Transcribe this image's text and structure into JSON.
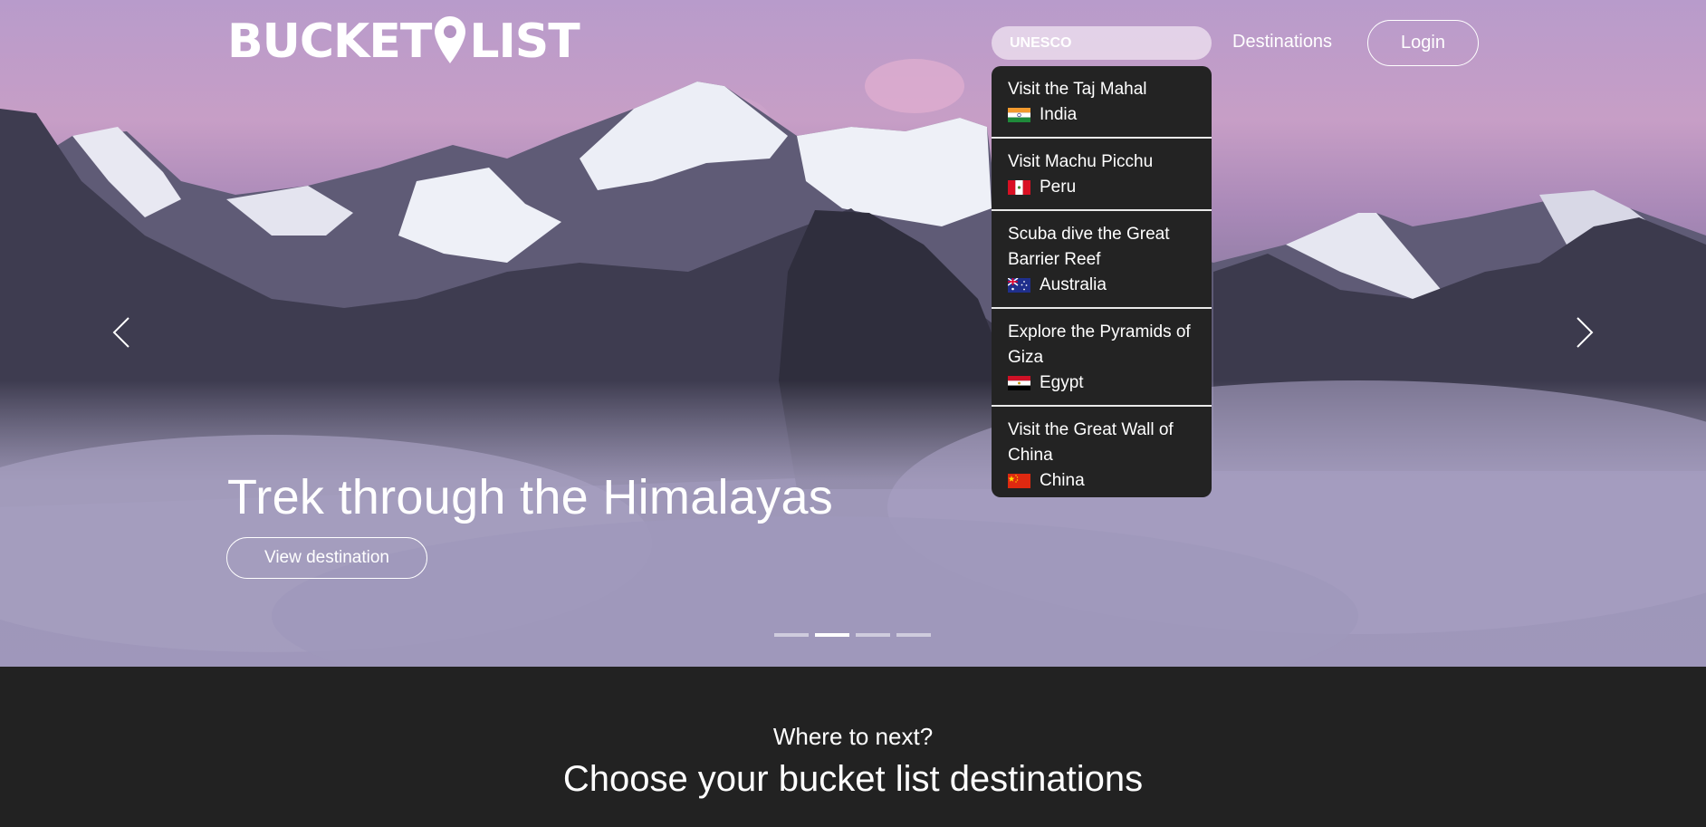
{
  "header": {
    "logo_text_left": "BUCKET",
    "logo_text_right": "LIST",
    "search_value": "UNESCO",
    "nav_destinations": "Destinations",
    "login_label": "Login"
  },
  "search_results": [
    {
      "title": "Visit the Taj Mahal",
      "country": "India",
      "flag_icon": "india-flag-icon"
    },
    {
      "title": "Visit Machu Picchu",
      "country": "Peru",
      "flag_icon": "peru-flag-icon"
    },
    {
      "title": "Scuba dive the Great Barrier Reef",
      "country": "Australia",
      "flag_icon": "australia-flag-icon"
    },
    {
      "title": "Explore the Pyramids of Giza",
      "country": "Egypt",
      "flag_icon": "egypt-flag-icon"
    },
    {
      "title": "Visit the Great Wall of China",
      "country": "China",
      "flag_icon": "china-flag-icon"
    }
  ],
  "hero": {
    "headline": "Trek through the Himalayas",
    "cta_label": "View destination",
    "slide_count": 4,
    "active_slide": 2,
    "prev_icon": "chevron-left-icon",
    "next_icon": "chevron-right-icon"
  },
  "section": {
    "subtitle": "Where to next?",
    "title": "Choose your bucket list destinations"
  },
  "colors": {
    "dark_background": "#222222",
    "dropdown_background": "#232323",
    "text": "#ffffff"
  }
}
